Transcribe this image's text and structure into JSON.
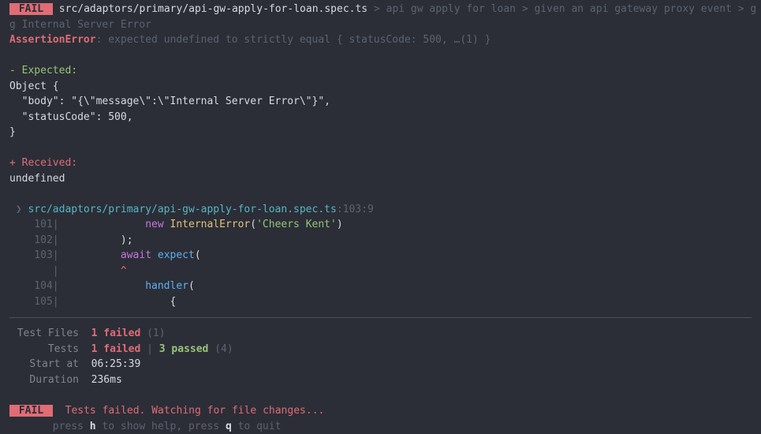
{
  "header": {
    "fail_badge": " FAIL ",
    "file": "src/adaptors/primary/api-gw-apply-for-loan.spec.ts",
    "sep": " > ",
    "suite1": "api gw apply for loan",
    "suite2": "given an api gateway proxy event",
    "suite3_trail": "g",
    "suite3_cont": "g Internal Server Error"
  },
  "assertion": {
    "label": "AssertionError",
    "message": ": expected undefined to strictly equal { statusCode: 500, …(1) }"
  },
  "diff": {
    "expected_header": "- Expected:",
    "obj_open": "Object {",
    "body_line": "  \"body\": \"{\\\"message\\\":\\\"Internal Server Error\\\"}\",",
    "status_line": "  \"statusCode\": 500,",
    "obj_close": "}",
    "received_header": "+ Received:",
    "received_value": "undefined"
  },
  "stack": {
    "pointer": "❯",
    "file": "src/adaptors/primary/api-gw-apply-for-loan.spec.ts",
    "loc": ":103:9"
  },
  "code": {
    "l101": {
      "num": "    101",
      "pipe": "|",
      "indent": "              ",
      "new": "new",
      "space1": " ",
      "type": "InternalError",
      "open": "(",
      "str": "'Cheers Kent'",
      "close": ")"
    },
    "l102": {
      "num": "    102",
      "pipe": "|",
      "text": "          );"
    },
    "l103": {
      "num": "    103",
      "pipe": "|",
      "indent": "          ",
      "await": "await",
      "space1": " ",
      "expect": "expect",
      "open": "("
    },
    "caret": {
      "num": "       ",
      "pipe": "|",
      "text": "          ^"
    },
    "l104": {
      "num": "    104",
      "pipe": "|",
      "indent": "              ",
      "fn": "handler",
      "open": "("
    },
    "l105": {
      "num": "    105",
      "pipe": "|",
      "text": "                  {"
    }
  },
  "summary": {
    "test_files_label": "Test Files",
    "test_files_fail": "1 failed",
    "test_files_total": " (1)",
    "tests_label": "Tests",
    "tests_fail": "1 failed",
    "tests_sep": " | ",
    "tests_pass": "3 passed",
    "tests_total": " (4)",
    "start_label": "Start at",
    "start_val": "06:25:39",
    "duration_label": "Duration",
    "duration_val": "236ms"
  },
  "footer": {
    "fail_badge": " FAIL ",
    "watching": "Tests failed. Watching for file changes...",
    "hint_prefix": "       press ",
    "hint_h": "h",
    "hint_mid": " to show help, press ",
    "hint_q": "q",
    "hint_suffix": " to quit"
  }
}
